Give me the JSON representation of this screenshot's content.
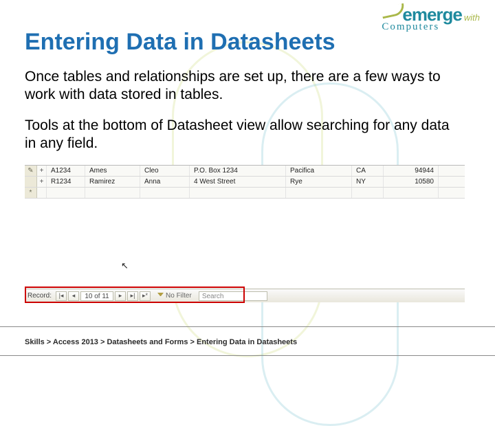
{
  "logo": {
    "brand": "emerge",
    "with": "with",
    "sub": "Computers"
  },
  "title": "Entering Data in Datasheets",
  "para1": "Once tables and relationships are set up, there are a few ways to work with data stored in tables.",
  "para2": "Tools at the bottom of Datasheet view allow searching for any data in any field.",
  "grid": {
    "rows": [
      {
        "marker": "✎",
        "expand": "+",
        "id": "A1234",
        "lastname": "Ames",
        "firstname": "Cleo",
        "address": "P.O. Box 1234",
        "city": "Pacifica",
        "state": "CA",
        "zip": "94944"
      },
      {
        "marker": "",
        "expand": "+",
        "id": "R1234",
        "lastname": "Ramirez",
        "firstname": "Anna",
        "address": "4 West Street",
        "city": "Rye",
        "state": "NY",
        "zip": "10580"
      }
    ],
    "new_row_marker": "*"
  },
  "navbar": {
    "label": "Record:",
    "first": "|◂",
    "prev": "◂",
    "position": "10 of 11",
    "next": "▸",
    "last": "▸|",
    "new": "▸*",
    "filter_label": "No Filter",
    "search_placeholder": "Search"
  },
  "breadcrumb": "Skills > Access 2013 > Datasheets and Forms > Entering Data in Datasheets"
}
